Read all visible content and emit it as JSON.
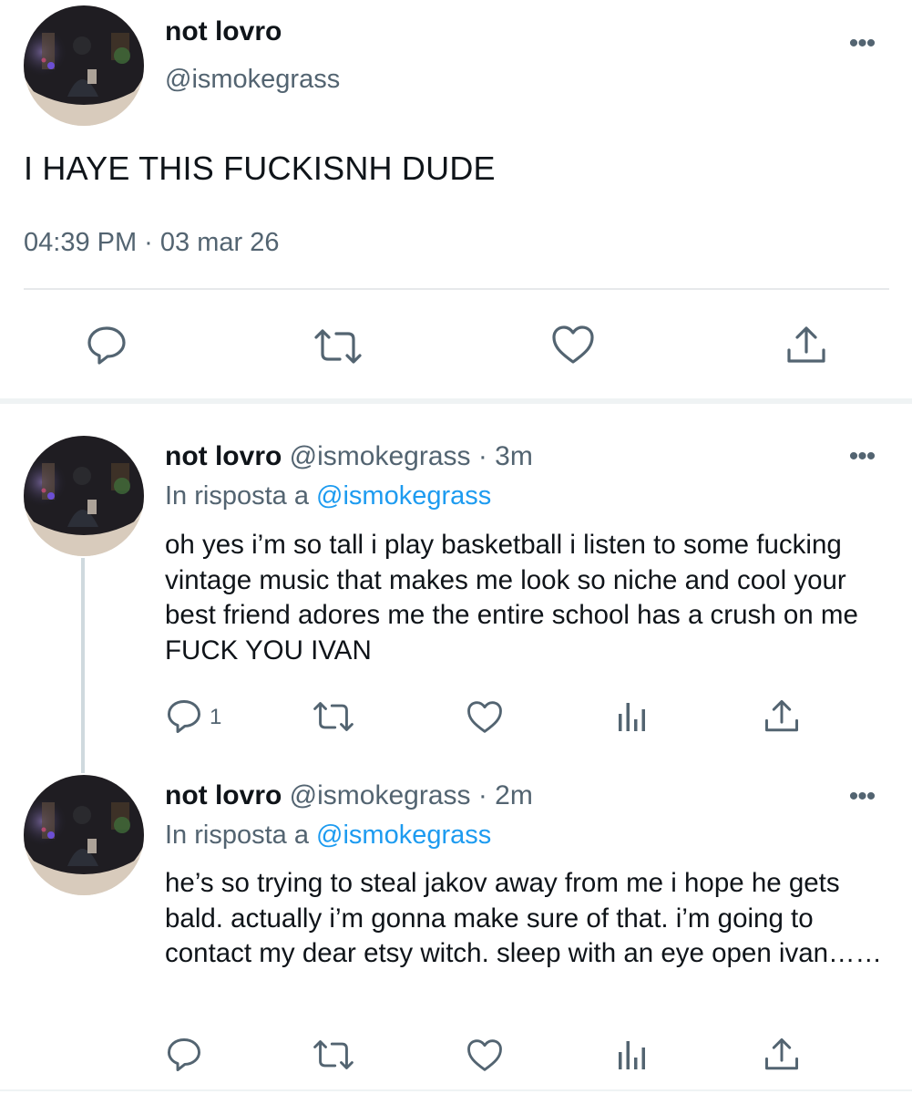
{
  "main_tweet": {
    "display_name": "not lovro",
    "handle": "@ismokegrass",
    "text": "I HAYE THIS FUCKISNH DUDE",
    "timestamp": "04:39 PM · 03 mar 26",
    "more_icon": "more-horizontal-icon",
    "actions": [
      "reply-icon",
      "retweet-icon",
      "like-icon",
      "share-icon"
    ]
  },
  "replies": [
    {
      "display_name": "not lovro",
      "handle_time": "@ismokegrass · 3m",
      "reply_to_label": "In risposta a",
      "reply_to_handle": "@ismokegrass",
      "text": "oh yes i’m so tall i play basketball i listen to some fucking vintage music that makes me look so niche and cool your best friend adores me the entire school has a crush on me FUCK YOU IVAN",
      "reply_count": "1"
    },
    {
      "display_name": "not lovro",
      "handle_time": "@ismokegrass · 2m",
      "reply_to_label": "In risposta a",
      "reply_to_handle": "@ismokegrass",
      "text": "he’s so trying to steal jakov away from me i hope he gets bald. actually i’m gonna make sure of that. i’m going to contact my dear etsy witch. sleep with an eye open ivan……",
      "reply_count": ""
    }
  ],
  "colors": {
    "text": "#0f1419",
    "secondary": "#536471",
    "link": "#1d9bf0",
    "divider": "#eff3f4"
  }
}
